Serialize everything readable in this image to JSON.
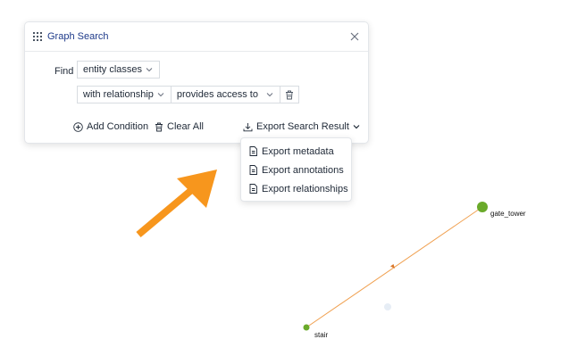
{
  "panel": {
    "title": "Graph Search",
    "find_label": "Find",
    "entity_select": "entity classes",
    "relationship_select": "with relationship",
    "relationship_value": "provides access to",
    "add_condition": "Add Condition",
    "clear_all": "Clear All",
    "export_button": "Export Search Result"
  },
  "export_menu": {
    "items": [
      {
        "label": "Export metadata"
      },
      {
        "label": "Export annotations"
      },
      {
        "label": "Export relationships"
      }
    ]
  },
  "graph": {
    "nodes": [
      {
        "label": "gate_tower"
      },
      {
        "label": "stair"
      }
    ],
    "colors": {
      "node": "#6aaa2a",
      "edge": "#f0a050",
      "arrow_annotation": "#f7961d",
      "ghost_node": "#e6edf5"
    }
  }
}
